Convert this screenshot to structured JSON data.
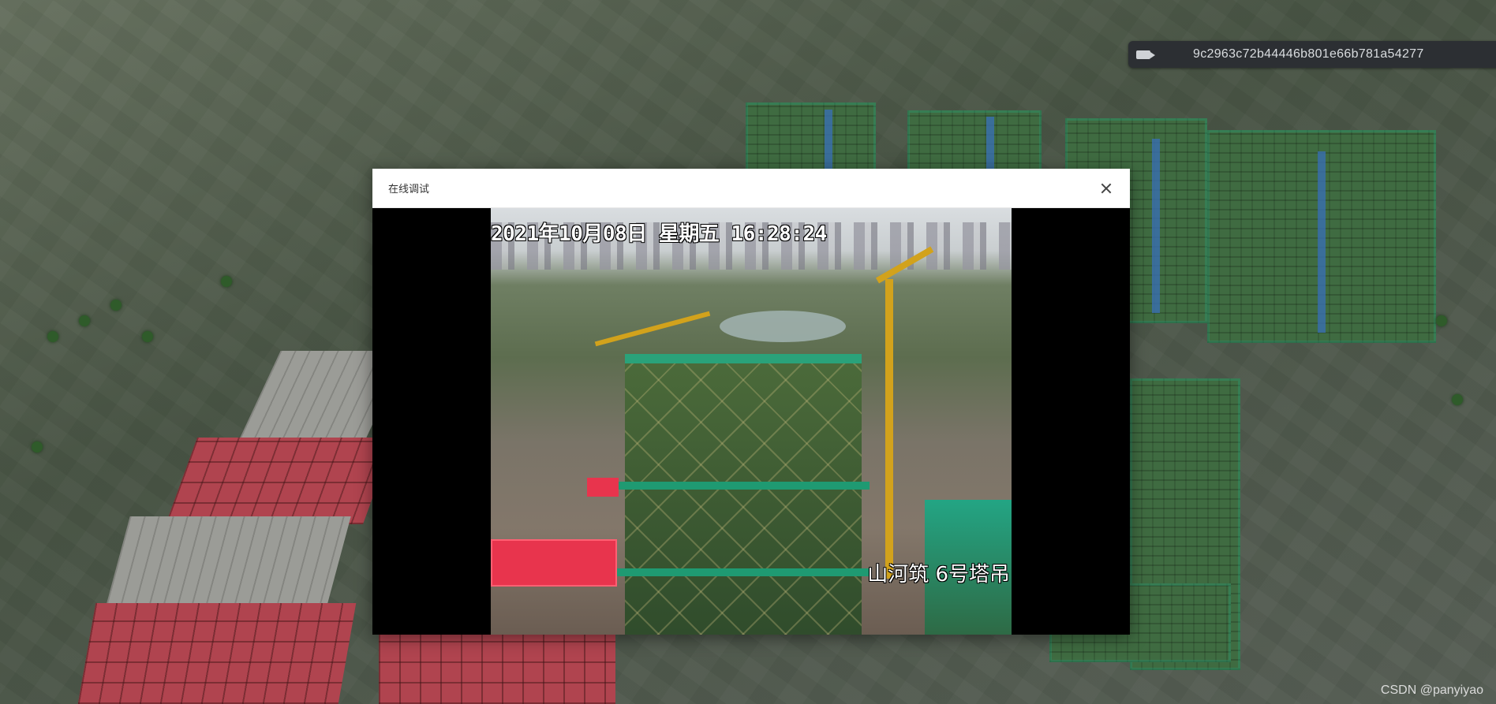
{
  "camera_id_bar": {
    "icon": "camera-icon",
    "camera_id": "9c2963c72b44446b801e66b781a54277"
  },
  "dialog": {
    "title": "在线调试",
    "close_icon": "close-icon"
  },
  "video": {
    "timestamp": "2021年10月08日  星期五  16:28:24",
    "camera_name": "山河筑 6号塔吊"
  },
  "watermark": {
    "text": "CSDN @panyiyao"
  },
  "colors": {
    "dialog_header_bg": "#ffffff",
    "video_letterbox": "#000000",
    "id_bar_bg": "#2c2f33"
  }
}
